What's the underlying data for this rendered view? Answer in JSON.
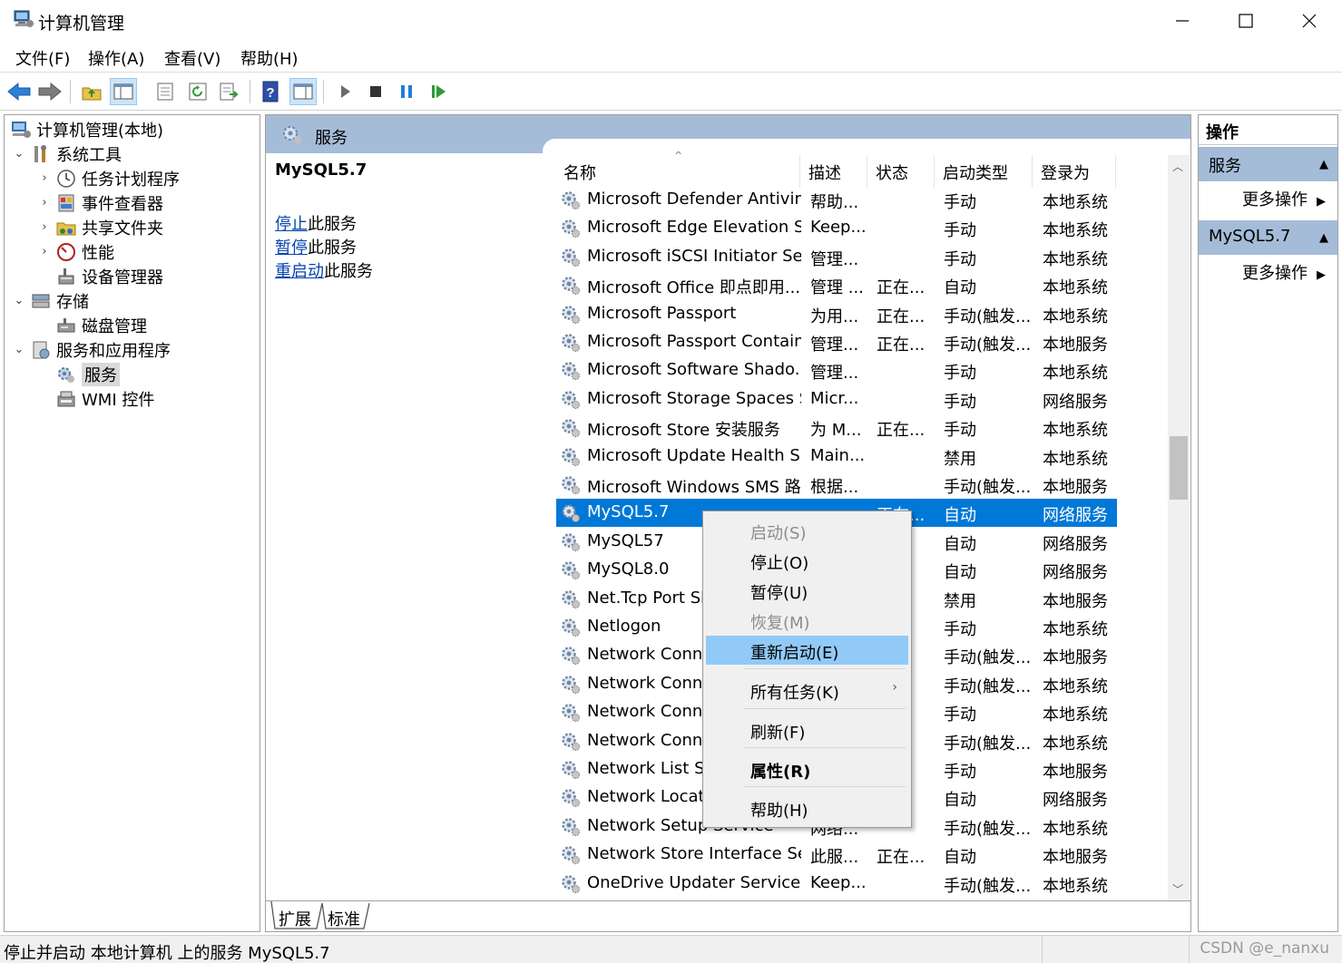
{
  "window": {
    "title": "计算机管理"
  },
  "menubar": [
    "文件(F)",
    "操作(A)",
    "查看(V)",
    "帮助(H)"
  ],
  "tree": {
    "root": "计算机管理(本地)",
    "system_tools": "系统工具",
    "task_scheduler": "任务计划程序",
    "event_viewer": "事件查看器",
    "shared_folders": "共享文件夹",
    "performance": "性能",
    "device_manager": "设备管理器",
    "storage": "存储",
    "disk_management": "磁盘管理",
    "services_apps": "服务和应用程序",
    "services": "服务",
    "wmi": "WMI 控件"
  },
  "center": {
    "header": "服务",
    "selected_service": "MySQL5.7",
    "actions": [
      {
        "link": "停止",
        "suffix": "此服务"
      },
      {
        "link": "暂停",
        "suffix": "此服务"
      },
      {
        "link": "重启动",
        "suffix": "此服务"
      }
    ],
    "columns": {
      "name": "名称",
      "desc": "描述",
      "status": "状态",
      "startup": "启动类型",
      "logon": "登录为"
    },
    "rows": [
      {
        "name": "Microsoft Defender Antivir...",
        "desc": "帮助...",
        "status": "",
        "startup": "手动",
        "logon": "本地系统"
      },
      {
        "name": "Microsoft Edge Elevation S...",
        "desc": "Keep...",
        "status": "",
        "startup": "手动",
        "logon": "本地系统"
      },
      {
        "name": "Microsoft iSCSI Initiator Ser...",
        "desc": "管理...",
        "status": "",
        "startup": "手动",
        "logon": "本地系统"
      },
      {
        "name": "Microsoft Office 即点即用...",
        "desc": "管理 ...",
        "status": "正在...",
        "startup": "自动",
        "logon": "本地系统"
      },
      {
        "name": "Microsoft Passport",
        "desc": "为用...",
        "status": "正在...",
        "startup": "手动(触发...",
        "logon": "本地系统"
      },
      {
        "name": "Microsoft Passport Container",
        "desc": "管理...",
        "status": "正在...",
        "startup": "手动(触发...",
        "logon": "本地服务"
      },
      {
        "name": "Microsoft Software Shado...",
        "desc": "管理...",
        "status": "",
        "startup": "手动",
        "logon": "本地系统"
      },
      {
        "name": "Microsoft Storage Spaces S...",
        "desc": "Micr...",
        "status": "",
        "startup": "手动",
        "logon": "网络服务"
      },
      {
        "name": "Microsoft Store 安装服务",
        "desc": "为 M...",
        "status": "正在...",
        "startup": "手动",
        "logon": "本地系统"
      },
      {
        "name": "Microsoft Update Health S...",
        "desc": "Main...",
        "status": "",
        "startup": "禁用",
        "logon": "本地系统"
      },
      {
        "name": "Microsoft Windows SMS 路...",
        "desc": "根据...",
        "status": "",
        "startup": "手动(触发...",
        "logon": "本地服务"
      },
      {
        "name": "MySQL5.7",
        "desc": "",
        "status": "正在...",
        "startup": "自动",
        "logon": "网络服务",
        "selected": true
      },
      {
        "name": "MySQL57",
        "desc": "",
        "status": "",
        "startup": "自动",
        "logon": "网络服务"
      },
      {
        "name": "MySQL8.0",
        "desc": "",
        "status": "...",
        "startup": "自动",
        "logon": "网络服务"
      },
      {
        "name": "Net.Tcp Port Sh",
        "desc": "",
        "status": "",
        "startup": "禁用",
        "logon": "本地服务"
      },
      {
        "name": "Netlogon",
        "desc": "",
        "status": "",
        "startup": "手动",
        "logon": "本地系统"
      },
      {
        "name": "Network Conne",
        "desc": "",
        "status": "",
        "startup": "手动(触发...",
        "logon": "本地服务"
      },
      {
        "name": "Network Conne",
        "desc": "",
        "status": "...",
        "startup": "手动(触发...",
        "logon": "本地系统"
      },
      {
        "name": "Network Conne",
        "desc": "",
        "status": "",
        "startup": "手动",
        "logon": "本地系统"
      },
      {
        "name": "Network Conne",
        "desc": "",
        "status": "",
        "startup": "手动(触发...",
        "logon": "本地系统"
      },
      {
        "name": "Network List Se",
        "desc": "",
        "status": "...",
        "startup": "手动",
        "logon": "本地服务"
      },
      {
        "name": "Network Locatic",
        "desc": "",
        "status": "...",
        "startup": "自动",
        "logon": "网络服务"
      },
      {
        "name": "Network Setup Service",
        "desc": "网络...",
        "status": "",
        "startup": "手动(触发...",
        "logon": "本地系统"
      },
      {
        "name": "Network Store Interface Se...",
        "desc": "此服...",
        "status": "正在...",
        "startup": "自动",
        "logon": "本地服务"
      },
      {
        "name": "OneDrive Updater Service",
        "desc": "Keep...",
        "status": "",
        "startup": "手动(触发...",
        "logon": "本地系统"
      }
    ],
    "tabs": [
      "扩展",
      "标准"
    ]
  },
  "context_menu": {
    "start": "启动(S)",
    "stop": "停止(O)",
    "pause": "暂停(U)",
    "resume": "恢复(M)",
    "restart": "重新启动(E)",
    "all_tasks": "所有任务(K)",
    "refresh": "刷新(F)",
    "properties": "属性(R)",
    "help": "帮助(H)"
  },
  "actions_pane": {
    "header": "操作",
    "section1": "服务",
    "more1": "更多操作",
    "section2": "MySQL5.7",
    "more2": "更多操作"
  },
  "statusbar": {
    "text": "停止并启动 本地计算机 上的服务 MySQL5.7",
    "watermark": "CSDN @e_nanxu"
  },
  "colors": {
    "selection": "#0078d7",
    "header_band": "#a4bcd8",
    "menu_hover": "#91c9f7"
  }
}
